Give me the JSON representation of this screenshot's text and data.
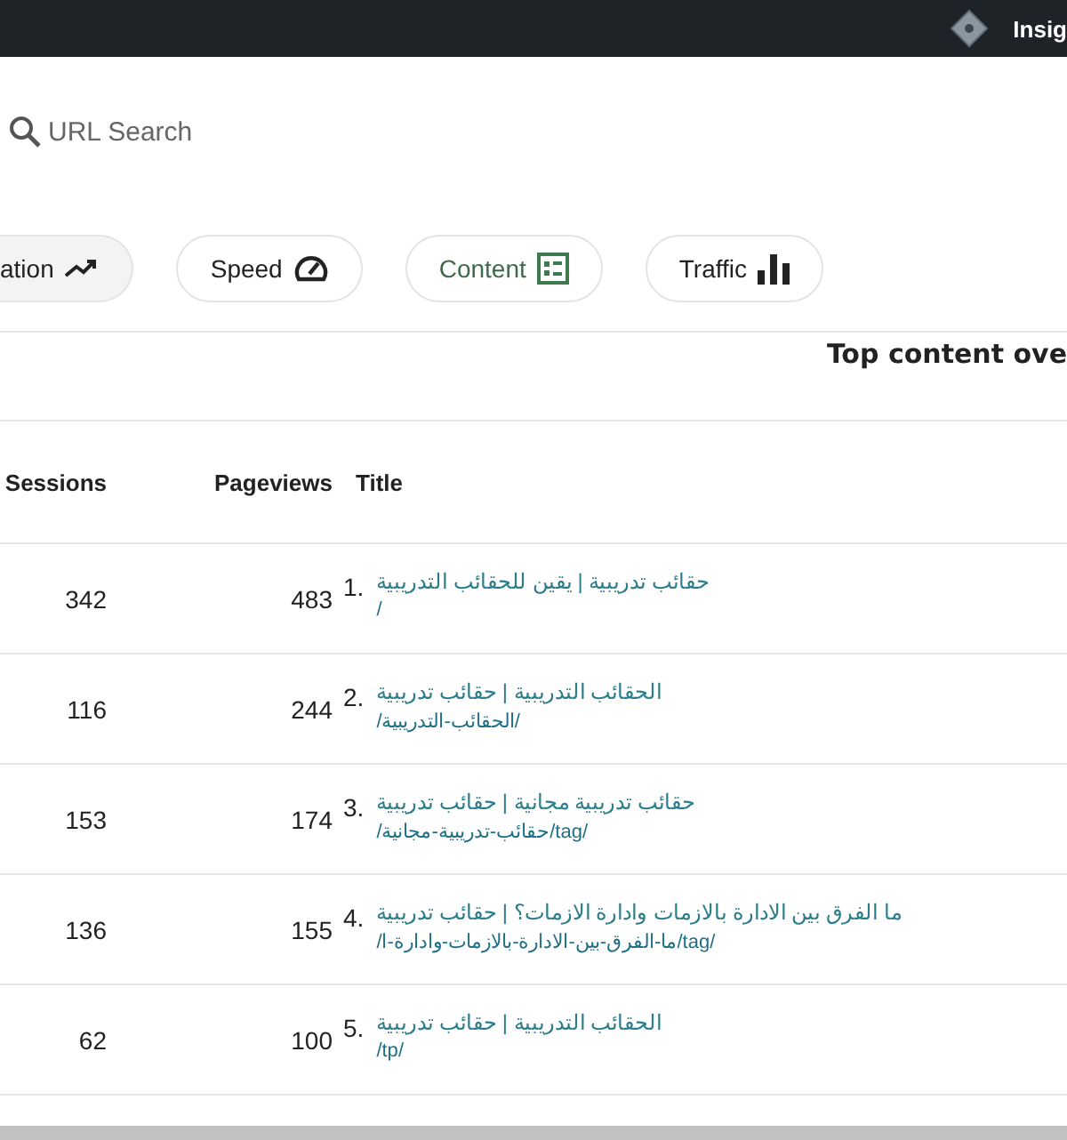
{
  "top_bar": {
    "label": "Insig"
  },
  "search": {
    "placeholder": "URL Search"
  },
  "tabs": [
    {
      "label": "ation",
      "kind": "trend",
      "selected": true,
      "highlighted": false
    },
    {
      "label": "Speed",
      "kind": "gauge",
      "selected": false,
      "highlighted": false
    },
    {
      "label": "Content",
      "kind": "sheet",
      "selected": false,
      "highlighted": true
    },
    {
      "label": "Traffic",
      "kind": "bars",
      "selected": false,
      "highlighted": false
    }
  ],
  "section_title": "Top content ove",
  "table": {
    "columns": [
      "Sessions",
      "Pageviews",
      "Title"
    ],
    "rows": [
      {
        "sessions": "342",
        "pageviews": "483",
        "number": "1.",
        "title": "حقائب تدريبية | يقين للحقائب التدريبية",
        "url": "/"
      },
      {
        "sessions": "116",
        "pageviews": "244",
        "number": "2.",
        "title": "الحقائب التدريبية | حقائب تدريبية",
        "url": "/الحقائب-التدريبية/"
      },
      {
        "sessions": "153",
        "pageviews": "174",
        "number": "3.",
        "title": "حقائب تدريبية مجانية | حقائب تدريبية",
        "url": "/tag/حقائب-تدريبية-مجانية/"
      },
      {
        "sessions": "136",
        "pageviews": "155",
        "number": "4.",
        "title": "ما الفرق بين الادارة بالازمات وادارة الازمات؟ | حقائب تدريبية",
        "url": "/tag/ما-الفرق-بين-الادارة-بالازمات-وادارة-ا/"
      },
      {
        "sessions": "62",
        "pageviews": "100",
        "number": "5.",
        "title": "الحقائب التدريبية | حقائب تدريبية",
        "url": "/tp/"
      }
    ]
  }
}
